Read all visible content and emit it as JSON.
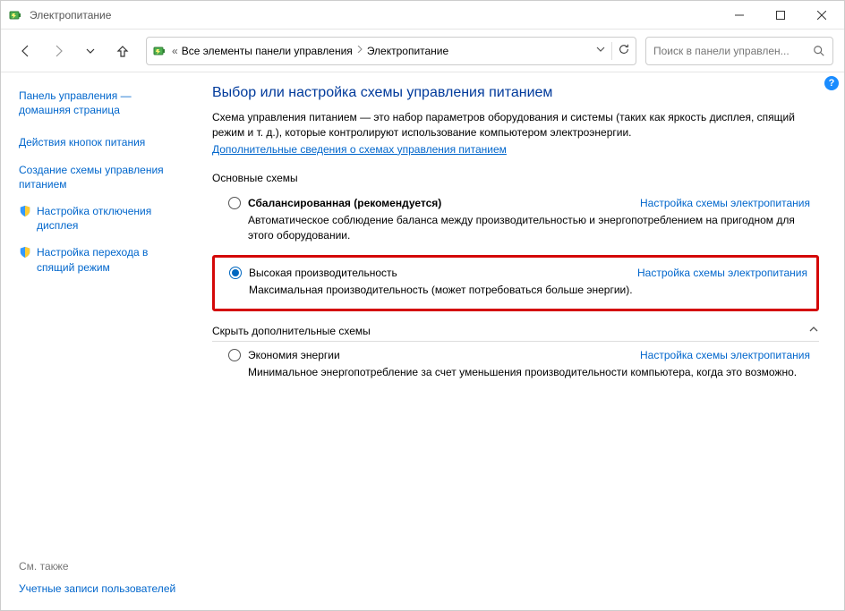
{
  "window": {
    "title": "Электропитание"
  },
  "breadcrumb": {
    "root_glyph": "«",
    "item1": "Все элементы панели управления",
    "item2": "Электропитание"
  },
  "search": {
    "placeholder": "Поиск в панели управлен..."
  },
  "sidebar": {
    "home": "Панель управления — домашняя страница",
    "item1": "Действия кнопок питания",
    "item2": "Создание схемы управления питанием",
    "item3": "Настройка отключения дисплея",
    "item4": "Настройка перехода в спящий режим",
    "see_also_label": "См. также",
    "see_also_item": "Учетные записи пользователей"
  },
  "main": {
    "heading": "Выбор или настройка схемы управления питанием",
    "intro": "Схема управления питанием — это набор параметров оборудования и системы (таких как яркость дисплея, спящий режим и т. д.), которые контролируют использование компьютером электроэнергии.",
    "intro_link": "Дополнительные сведения о схемах управления питанием",
    "section_main_title": "Основные схемы",
    "section_hide_title": "Скрыть дополнительные схемы",
    "plan_settings_link": "Настройка схемы электропитания",
    "plans": {
      "balanced": {
        "name": "Сбалансированная (рекомендуется)",
        "desc": "Автоматическое соблюдение баланса между производительностью и энергопотреблением на пригодном для этого оборудовании."
      },
      "high": {
        "name": "Высокая производительность",
        "desc": "Максимальная производительность (может потребоваться больше энергии)."
      },
      "eco": {
        "name": "Экономия энергии",
        "desc": "Минимальное энергопотребление за счет уменьшения производительности компьютера, когда это возможно."
      }
    }
  }
}
